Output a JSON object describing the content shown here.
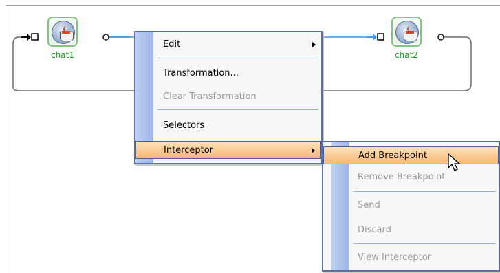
{
  "nodes": [
    {
      "label": "chat1"
    },
    {
      "label": "chat2"
    }
  ],
  "context_menu": {
    "items": [
      {
        "label": "Edit",
        "has_submenu": true,
        "enabled": true
      },
      {
        "label": "Transformation...",
        "has_submenu": false,
        "enabled": true
      },
      {
        "label": "Clear Transformation",
        "has_submenu": false,
        "enabled": false
      },
      {
        "label": "Selectors",
        "has_submenu": false,
        "enabled": true
      },
      {
        "label": "Interceptor",
        "has_submenu": true,
        "enabled": true,
        "highlighted": true
      }
    ]
  },
  "submenu": {
    "items": [
      {
        "label": "Add Breakpoint",
        "enabled": true,
        "highlighted": true
      },
      {
        "label": "Remove Breakpoint",
        "enabled": false
      },
      {
        "label": "Send",
        "enabled": false
      },
      {
        "label": "Discard",
        "enabled": false
      },
      {
        "label": "View Interceptor",
        "enabled": false
      }
    ]
  },
  "colors": {
    "node_border": "#7cc97c",
    "node_label": "#1d9a1d",
    "wire": "#6b6b6b",
    "wire_selected": "#4a90e2",
    "menu_border": "#5a6fa8",
    "highlight": "#f6b777"
  }
}
